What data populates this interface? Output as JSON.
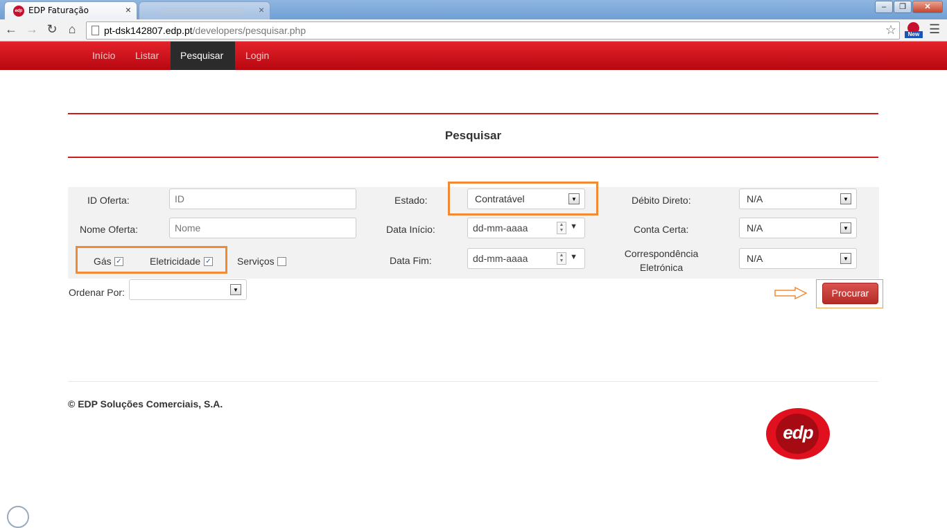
{
  "browser": {
    "tab_active_title": "EDP Faturação",
    "tab_close": "×",
    "tab2_close": "×",
    "url_host": "pt-dsk142807.edp.pt",
    "url_path": "/developers/pesquisar.php",
    "ext_badge": "New",
    "win_min": "–",
    "win_max": "❐",
    "win_close": "✕"
  },
  "nav": {
    "items": [
      "Início",
      "Listar",
      "Pesquisar",
      "Login"
    ],
    "active": "Pesquisar"
  },
  "page": {
    "title": "Pesquisar"
  },
  "form": {
    "id_oferta_label": "ID Oferta:",
    "id_oferta_placeholder": "ID",
    "nome_oferta_label": "Nome Oferta:",
    "nome_oferta_placeholder": "Nome",
    "gas_label": "Gás",
    "gas_checked": true,
    "eletricidade_label": "Eletricidade",
    "eletricidade_checked": true,
    "servicos_label": "Serviços",
    "servicos_checked": false,
    "estado_label": "Estado:",
    "estado_value": "Contratável",
    "data_inicio_label": "Data Início:",
    "data_inicio_value": "dd-mm-aaaa",
    "data_fim_label": "Data Fim:",
    "data_fim_value": "dd-mm-aaaa",
    "debito_label": "Débito Direto:",
    "debito_value": "N/A",
    "conta_label": "Conta Certa:",
    "conta_value": "N/A",
    "corresp_label_line1": "Correspondência",
    "corresp_label_line2": "Eletrónica",
    "corresp_value": "N/A",
    "ordenar_label": "Ordenar Por:",
    "ordenar_value": "",
    "submit_label": "Procurar",
    "check_mark": "✓"
  },
  "footer": {
    "copyright": "© EDP Soluções Comerciais, S.A.",
    "logo_text": "edp"
  },
  "colors": {
    "brand_red": "#d11a1f",
    "highlight_orange": "#f08b33"
  }
}
